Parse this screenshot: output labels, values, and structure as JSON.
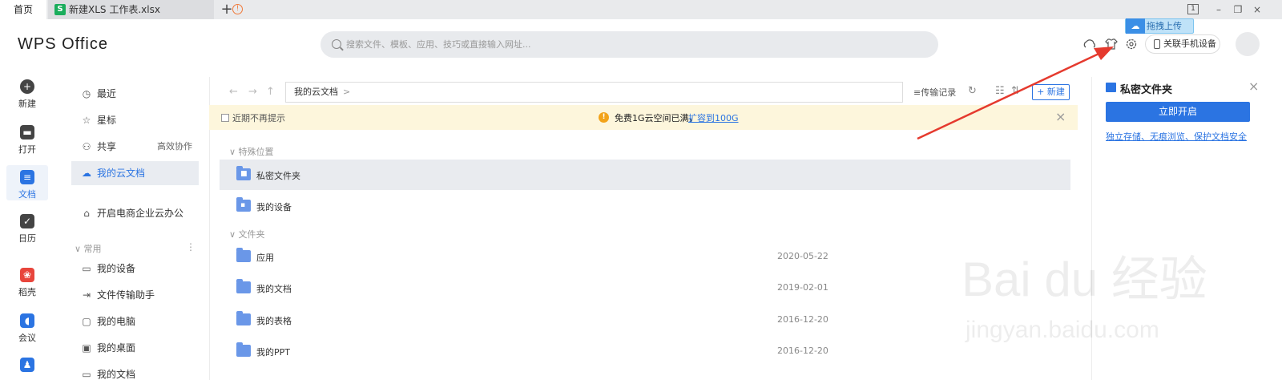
{
  "tabs": {
    "home": "首页",
    "file_icon": "S",
    "file": "新建XLS 工作表.xlsx",
    "warn_icon": "!",
    "add": "+"
  },
  "window": {
    "box": "1",
    "min": "–",
    "restore": "❐",
    "close": "×"
  },
  "header": {
    "logo": "WPS Office",
    "search_placeholder": "搜索文件、模板、应用、技巧或直接输入网址...",
    "phone_button": "关联手机设备",
    "upload_tip": "拖拽上传",
    "upload_icon": "☁"
  },
  "rail": [
    {
      "label": "新建",
      "icon": "+",
      "color": "#444"
    },
    {
      "label": "打开",
      "icon": "▬",
      "color": "#444"
    },
    {
      "label": "文档",
      "icon": "≡",
      "color": "#2b74e2"
    },
    {
      "label": "日历",
      "icon": "✓",
      "color": "#444"
    },
    {
      "label": "稻壳",
      "icon": "❀",
      "color": "#e8453c"
    },
    {
      "label": "会议",
      "icon": "◖",
      "color": "#2b74e2"
    },
    {
      "label": "",
      "icon": "♟",
      "color": "#2b74e2"
    }
  ],
  "nav": {
    "recent": "最近",
    "star": "星标",
    "share": "共享",
    "share_badge": "高效协作",
    "cloud": "我的云文档",
    "ecommerce": "开启电商企业云办公",
    "group_label": "∨ 常用",
    "group_more": "⋮",
    "devices": "我的设备",
    "transfer": "文件传输助手",
    "pc": "我的电脑",
    "desktop": "我的桌面",
    "docs_partial": "我的文档"
  },
  "pathbar": {
    "back": "←",
    "forward": "→",
    "up": "↑",
    "path": "我的云文档",
    "path_chevron": ">",
    "transfer": "传输记录",
    "refresh": "↻",
    "view": "☷",
    "sort": "⇅",
    "new": "+ 新建"
  },
  "notice": {
    "checkbox_label": "近期不再提示",
    "info_icon": "!",
    "message": "免费1G云空间已满，",
    "link": "扩容到100G",
    "close": "×"
  },
  "sections": {
    "special": "∨ 特殊位置",
    "folders": "∨ 文件夹"
  },
  "special_rows": [
    {
      "name": "私密文件夹",
      "icon": "🔒"
    },
    {
      "name": "我的设备",
      "icon": "▣"
    }
  ],
  "folder_rows": [
    {
      "name": "应用",
      "date": "2020-05-22"
    },
    {
      "name": "我的文档",
      "date": "2019-02-01"
    },
    {
      "name": "我的表格",
      "date": "2016-12-20"
    },
    {
      "name": "我的PPT",
      "date": "2016-12-20"
    }
  ],
  "right_panel": {
    "title": "私密文件夹",
    "close": "×",
    "button": "立即开启",
    "link": "独立存储、无痕浏览、保护文档安全"
  },
  "watermark": {
    "line1": "Bai du 经验",
    "line2": "jingyan.baidu.com"
  },
  "colors": {
    "accent": "#2b74e2",
    "notice_bg": "#fdf6dc",
    "arrow": "#e53a2e"
  }
}
